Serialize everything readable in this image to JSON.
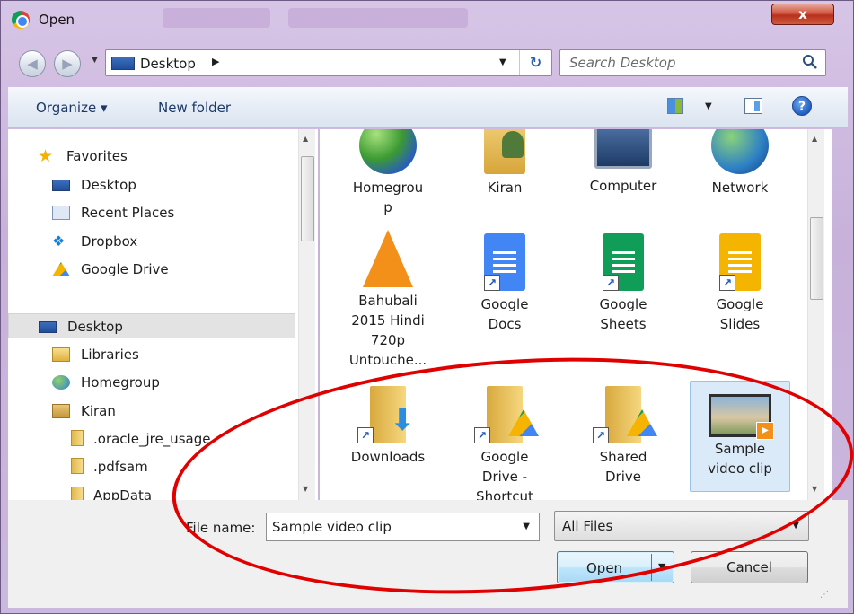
{
  "window": {
    "title": "Open",
    "close_glyph": "x"
  },
  "address": {
    "location": "Desktop",
    "search_placeholder": "Search Desktop"
  },
  "toolbar": {
    "organize": "Organize ▾",
    "new_folder": "New folder",
    "help": "?"
  },
  "navpane": {
    "favorites": {
      "label": "Favorites",
      "items": [
        "Desktop",
        "Recent Places",
        "Dropbox",
        "Google Drive"
      ]
    },
    "tree": {
      "root": "Desktop",
      "items": [
        "Libraries",
        "Homegroup",
        "Kiran"
      ],
      "subitems": [
        ".oracle_jre_usage",
        ".pdfsam",
        "AppData"
      ]
    }
  },
  "files": [
    {
      "name": "Homegrou\np",
      "icon": "homegroup-icon"
    },
    {
      "name": "Kiran",
      "icon": "user-folder-icon"
    },
    {
      "name": "Computer",
      "icon": "computer-icon"
    },
    {
      "name": "Network",
      "icon": "network-icon"
    },
    {
      "name": "Bahubali\n2015 Hindi\n720p\nUntouche...",
      "icon": "vlc-cone-icon"
    },
    {
      "name": "Google\nDocs",
      "icon": "google-docs-icon"
    },
    {
      "name": "Google\nSheets",
      "icon": "google-sheets-icon"
    },
    {
      "name": "Google\nSlides",
      "icon": "google-slides-icon"
    },
    {
      "name": "Downloads",
      "icon": "downloads-folder-icon"
    },
    {
      "name": "Google\nDrive -\nShortcut",
      "icon": "drive-folder-icon"
    },
    {
      "name": "Shared\nDrive",
      "icon": "drive-folder-icon"
    },
    {
      "name": "Sample\nvideo clip",
      "icon": "video-thumbnail-icon"
    }
  ],
  "bottom": {
    "file_name_label": "File name:",
    "file_name_value": "Sample video clip",
    "filter_value": "All Files",
    "open_label": "Open",
    "cancel_label": "Cancel"
  },
  "colors": {
    "annotation": "#e00000",
    "selection": "#dbeaf9",
    "frame": "#c7b1da"
  }
}
